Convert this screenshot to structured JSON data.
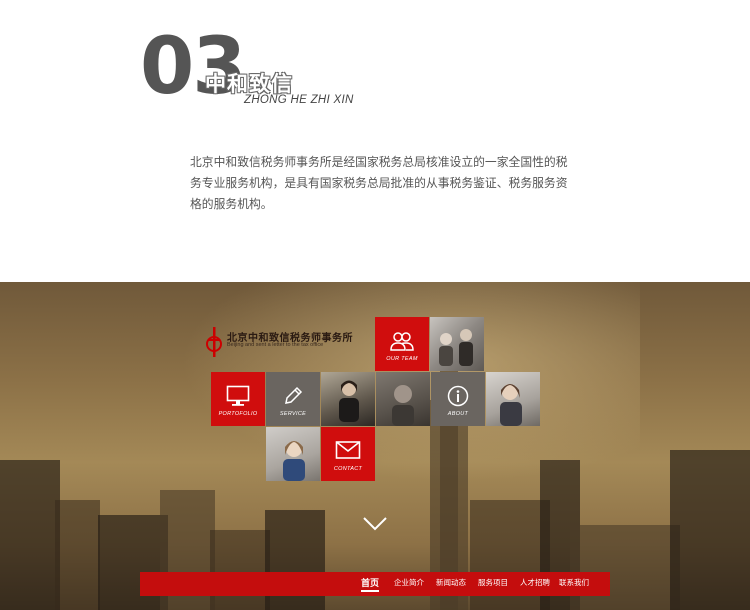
{
  "intro": {
    "number": "03",
    "title_cn": "中和致信",
    "title_en": "ZHONG HE ZHI XIN",
    "description": "北京中和致信税务师事务所是经国家税务总局核准设立的一家全国性的税务专业服务机构，是具有国家税务总局批准的从事税务鉴证、税务服务资格的服务机构。"
  },
  "hero": {
    "logo": {
      "name_cn": "北京中和致信税务师事务所",
      "name_en": "Beijing and sent a letter to the tax office"
    },
    "tiles": {
      "team": "OUR TEAM",
      "portfolio": "PORTOFOLIO",
      "service": "SERVICE",
      "about": "ABOUT",
      "contact": "CONTACT"
    }
  },
  "nav": {
    "items": [
      "首页",
      "企业简介",
      "新闻动态",
      "服务项目",
      "人才招聘",
      "联系我们"
    ],
    "active": "首页"
  },
  "colors": {
    "accent": "#d00d0d",
    "nav_bg": "#c40d0d",
    "number": "#555555"
  }
}
